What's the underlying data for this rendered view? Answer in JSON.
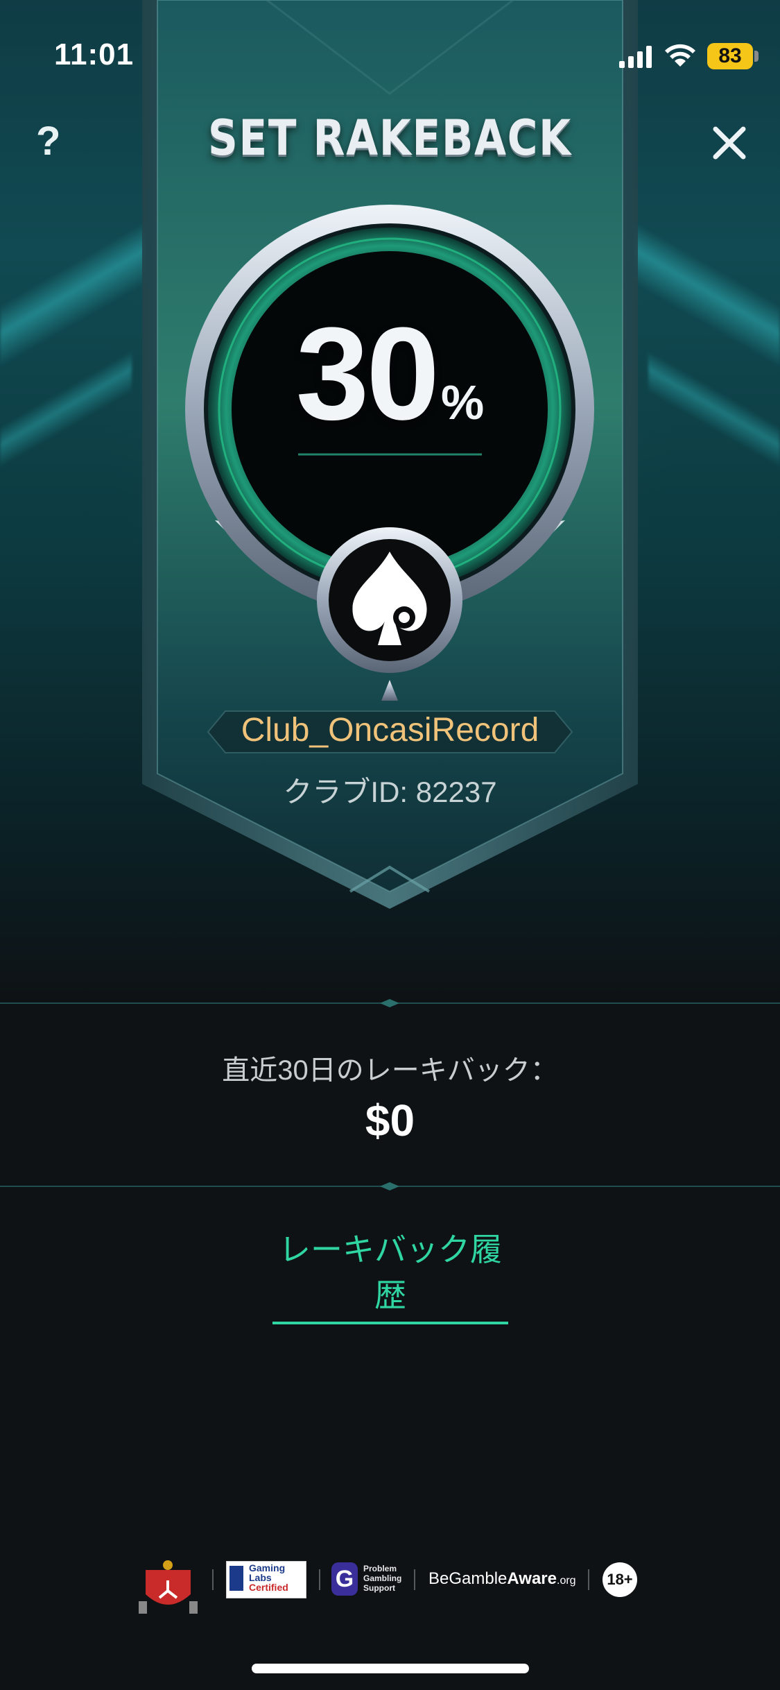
{
  "status_bar": {
    "time": "11:01",
    "battery": "83"
  },
  "header": {
    "title": "SET RAKEBACK",
    "help_label": "?"
  },
  "rakeback": {
    "rate": "30",
    "rate_unit": "%"
  },
  "club": {
    "name": "Club_OncasiRecord",
    "id_line": "クラブID: 82237"
  },
  "summary": {
    "label": "直近30日のレーキバック：",
    "value": "$0"
  },
  "links": {
    "history": "レーキバック履歴"
  },
  "footer": {
    "gli_line1": "Gaming",
    "gli_line2": "Labs",
    "gli_line3": "Certified",
    "pgs_line1": "Problem",
    "pgs_line2": "Gambling",
    "pgs_line3": "Support",
    "bga_be": "BeGamble",
    "bga_aware": "Aware",
    "bga_org": ".org",
    "age": "18+"
  },
  "colors": {
    "accent_green": "#2fd6a2",
    "club_gold": "#f0c27a",
    "battery_yellow": "#f5c518"
  }
}
